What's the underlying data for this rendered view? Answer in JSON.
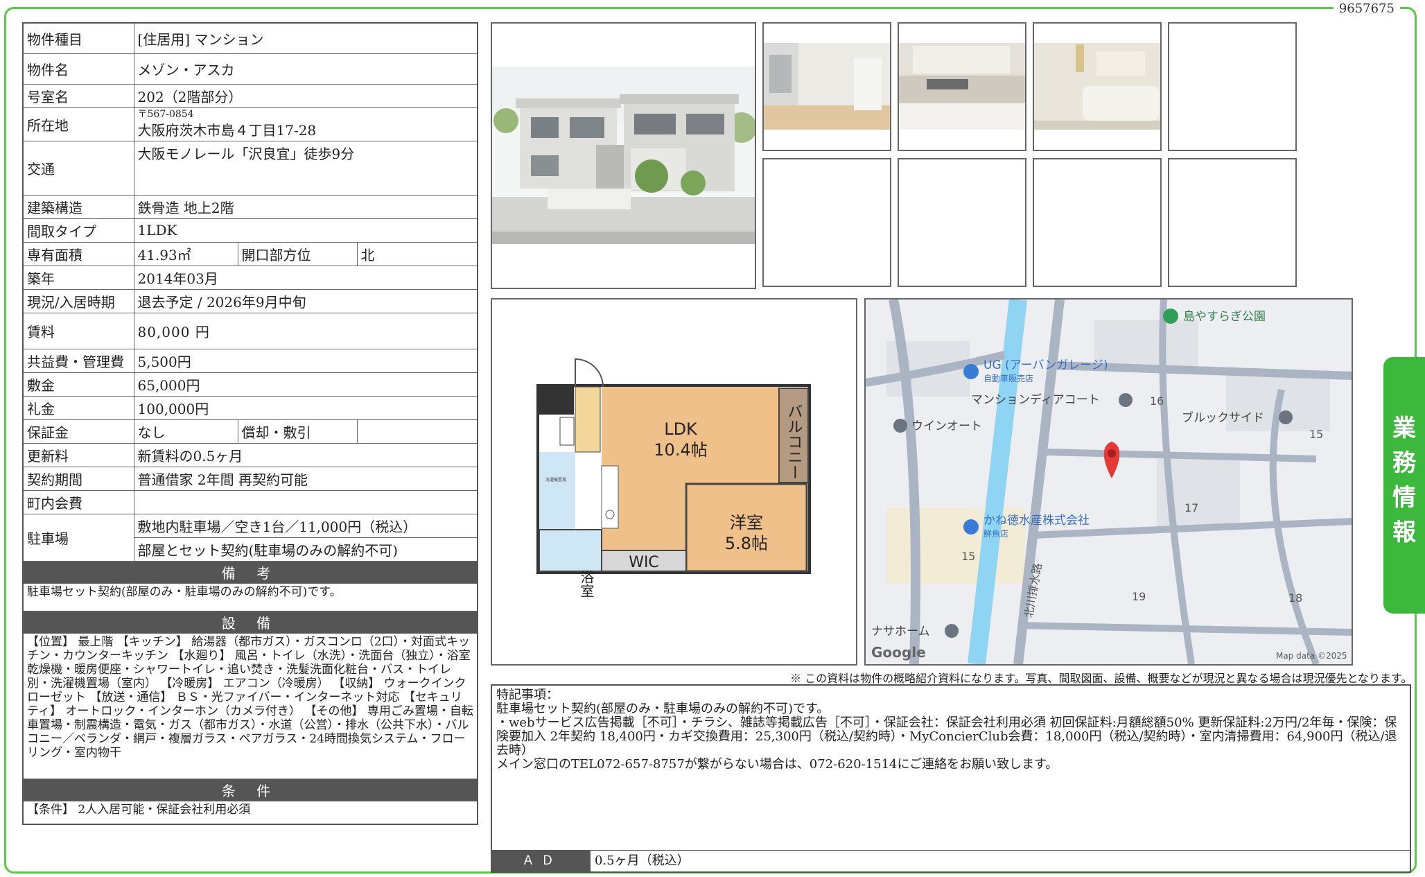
{
  "doc_id": "9657675",
  "property": {
    "type_label": "物件種目",
    "type_value": "[住居用] マンション",
    "name_label": "物件名",
    "name_value": "メゾン・アスカ",
    "room_label": "号室名",
    "room_value": "202（2階部分）",
    "address_label": "所在地",
    "zip": "〒567-0854",
    "address_value": "大阪府茨木市島４丁目17-28",
    "transit_label": "交通",
    "transit_value": "大阪モノレール「沢良宜」徒歩9分",
    "structure_label": "建築構造",
    "structure_value": "鉄骨造 地上2階",
    "layout_label": "間取タイプ",
    "layout_value": "1LDK",
    "area_label": "専有面積",
    "area_value": "41.93㎡",
    "facing_label": "開口部方位",
    "facing_value": "北",
    "built_label": "築年",
    "built_value": "2014年03月",
    "status_label": "現況/入居時期",
    "status_value": "退去予定 / 2026年9月中旬",
    "rent_label": "賃料",
    "rent_value": "80,000 円",
    "fee_label": "共益費・管理費",
    "fee_value": "5,500円",
    "deposit_label": "敷金",
    "deposit_value": "65,000円",
    "key_money_label": "礼金",
    "key_money_value": "100,000円",
    "guarantee_label": "保証金",
    "guarantee_value": "なし",
    "amort_label": "償却・敷引",
    "amort_value": "",
    "renewal_label": "更新料",
    "renewal_value": "新賃料の0.5ヶ月",
    "contract_label": "契約期間",
    "contract_value": "普通借家 2年間 再契約可能",
    "town_fee_label": "町内会費",
    "town_fee_value": "",
    "parking_label": "駐車場",
    "parking_value1": "敷地内駐車場／空き1台／11,000円（税込）",
    "parking_value2": "部屋とセット契約(駐車場のみの解約不可)"
  },
  "sections": {
    "remarks_title": "備 考",
    "remarks_text": "駐車場セット契約(部屋のみ・駐車場のみの解約不可)です。",
    "equipment_title": "設 備",
    "equipment_text": "【位置】 最上階 【キッチン】 給湯器（都市ガス）・ガスコンロ（2口）・対面式キッチン・カウンターキッチン 【水廻り】 風呂・トイレ（水洗）・洗面台（独立）・浴室乾燥機・暖房便座・シャワートイレ・追い焚き・洗髪洗面化粧台・バス・トイレ別・洗濯機置場（室内） 【冷暖房】 エアコン（冷暖房） 【収納】 ウォークインクローゼット 【放送・通信】 ＢＳ・光ファイバー・インターネット対応 【セキュリティ】 オートロック・インターホン（カメラ付き） 【その他】 専用ごみ置場・自転車置場・制震構造・電気・ガス（都市ガス）・水道（公営）・排水（公共下水）・バルコニー／ベランダ・網戸・複層ガラス・ペアガラス・24時間換気システム・フローリング・室内物干",
    "conditions_title": "条 件",
    "conditions_text": "【条件】 2人入居可能・保証会社利用必須"
  },
  "floorplan": {
    "ldk_label": "LDK",
    "ldk_size": "10.4帖",
    "western_label": "洋室",
    "western_size": "5.8帖",
    "bath_label": "浴室",
    "wic_label": "WIC",
    "balcony_label": "バルコニー",
    "washer_label": "洗濯機置場"
  },
  "map": {
    "park": "島やすらぎ公園",
    "ug_name": "UG (アーバンガレージ)",
    "ug_sub": "自動車販売店",
    "mansion": "マンションディアコート",
    "winauto": "ウインオート",
    "brook": "ブルックサイド",
    "kane": "かね徳水産株式会社",
    "kane_sub": "鮮魚店",
    "nasa": "ナサホーム",
    "river": "北川排水路",
    "n16": "16",
    "n15a": "15",
    "n17": "17",
    "n15b": "15",
    "n19": "19",
    "n18": "18",
    "logo": "Google",
    "credit": "Map data ©2025"
  },
  "disclaimer": "※ この資料は物件の概略紹介資料になります。写真、間取図面、設備、概要などが現況と異なる場合は現況優先となります。",
  "special": {
    "title": "特記事項：",
    "line1": "駐車場セット契約(部屋のみ・駐車場のみの解約不可)です。",
    "line2": "・webサービス広告掲載［不可］・チラシ、雑誌等掲載広告［不可］・保証会社：保証会社利用必須 初回保証料:月額総額50% 更新保証料:2万円/2年毎・保険：保険要加入 2年契約 18,400円・カギ交換費用：25,300円（税込/契約時）・MyConcierClub会費：18,000円（税込/契約時）・室内清掃費用：64,900円（税込/退去時）",
    "line3": "メイン窓口のTEL072-657-8757が繋がらない場合は、072-620-1514にご連絡をお願い致します。",
    "ad_label": "ＡＤ",
    "ad_value": "0.5ヶ月（税込）"
  },
  "side_tab": [
    "業",
    "務",
    "情",
    "報"
  ],
  "colors": {
    "green": "#3cb83c",
    "header_gray": "#555555"
  }
}
